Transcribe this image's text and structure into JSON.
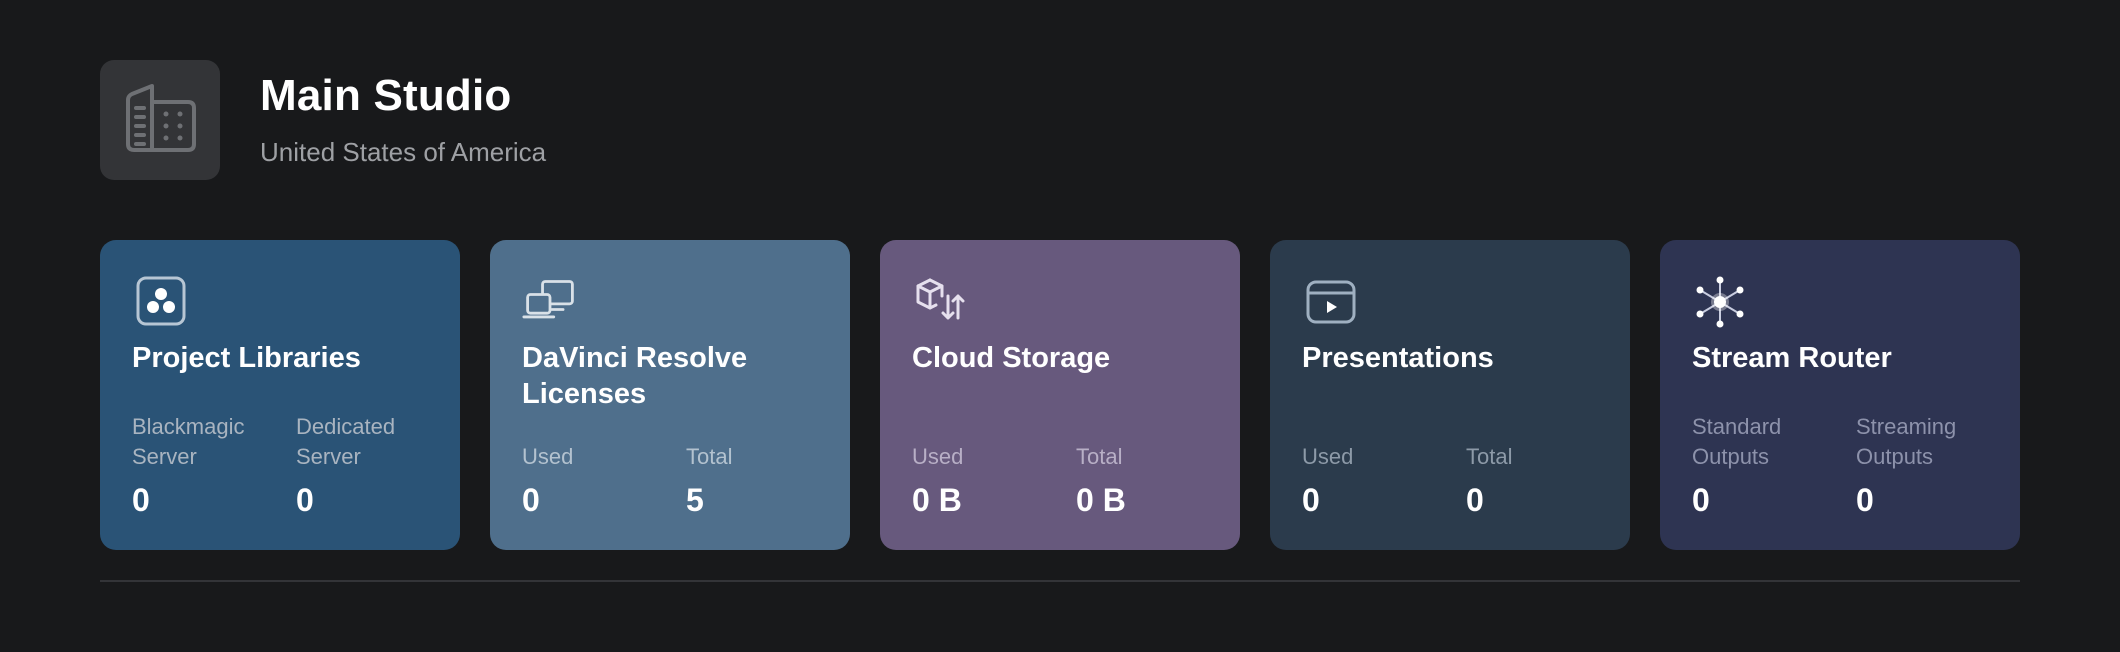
{
  "studio": {
    "title": "Main Studio",
    "subtitle": "United States of America",
    "icon": "building-icon"
  },
  "cards": [
    {
      "title": "Project Libraries",
      "icon": "project-libraries-icon",
      "color": "#2a5376",
      "stats": [
        {
          "label": "Blackmagic Server",
          "value": "0"
        },
        {
          "label": "Dedicated Server",
          "value": "0"
        }
      ]
    },
    {
      "title": "DaVinci Resolve Licenses",
      "icon": "devices-icon",
      "color": "#4f6f8c",
      "stats": [
        {
          "label": "Used",
          "value": "0"
        },
        {
          "label": "Total",
          "value": "5"
        }
      ]
    },
    {
      "title": "Cloud Storage",
      "icon": "cloud-sync-icon",
      "color": "#67597d",
      "stats": [
        {
          "label": "Used",
          "value": "0 B"
        },
        {
          "label": "Total",
          "value": "0 B"
        }
      ]
    },
    {
      "title": "Presentations",
      "icon": "presentation-play-icon",
      "color": "#2b3b4c",
      "stats": [
        {
          "label": "Used",
          "value": "0"
        },
        {
          "label": "Total",
          "value": "0"
        }
      ]
    },
    {
      "title": "Stream Router",
      "icon": "stream-router-icon",
      "color": "#2e3452",
      "stats": [
        {
          "label": "Standard Outputs",
          "value": "0"
        },
        {
          "label": "Streaming Outputs",
          "value": "0"
        }
      ]
    }
  ]
}
